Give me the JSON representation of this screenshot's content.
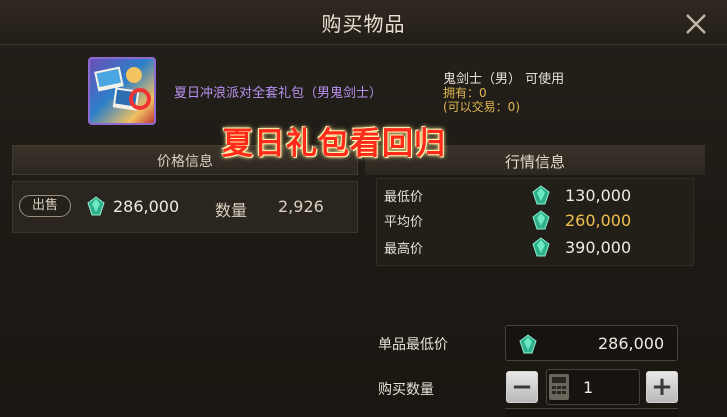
{
  "dialog": {
    "title": "购买物品"
  },
  "item": {
    "name": "夏日冲浪派对全套礼包（男鬼剑士）",
    "usable": "鬼剑士（男） 可使用",
    "owned": "拥有：0",
    "tradable": "(可以交易：0)"
  },
  "banner": "夏日礼包看回归",
  "listing": {
    "header": "价格信息",
    "sell_label": "出售",
    "price": "286,000",
    "qty_label": "数量",
    "qty_value": "2,926"
  },
  "market": {
    "header": "行情信息",
    "min_label": "最低价",
    "min_value": "130,000",
    "avg_label": "平均价",
    "avg_value": "260,000",
    "max_label": "最高价",
    "max_value": "390,000"
  },
  "purchase": {
    "unit_min_label": "单品最低价",
    "unit_min_value": "286,000",
    "qty_label": "购买数量",
    "minus": "−",
    "plus": "+",
    "qty_value": "1"
  },
  "colors": {
    "gem": "#3fc4a0",
    "avg_value": "#f0c050",
    "item_name": "#b891f0"
  }
}
